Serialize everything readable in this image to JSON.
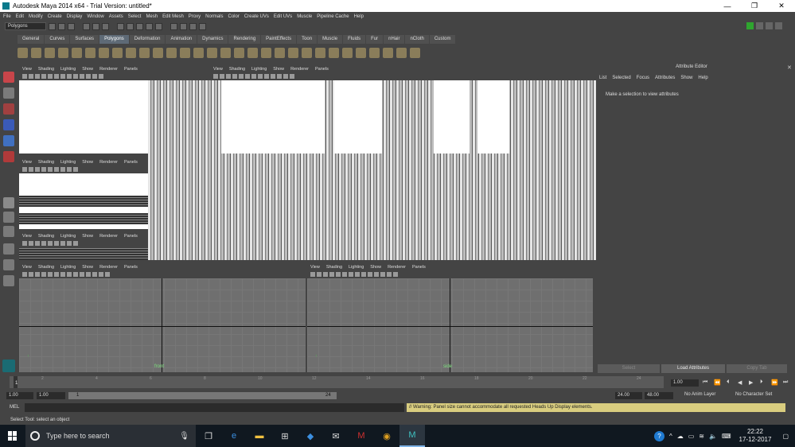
{
  "window": {
    "title": "Autodesk Maya 2014 x64 - Trial Version: untitled*",
    "minimize": "—",
    "maximize": "❐",
    "close": "✕"
  },
  "menu": [
    "File",
    "Edit",
    "Modify",
    "Create",
    "Display",
    "Window",
    "Assets",
    "Select",
    "Mesh",
    "Edit Mesh",
    "Proxy",
    "Normals",
    "Color",
    "Create UVs",
    "Edit UVs",
    "Muscle",
    "Pipeline Cache",
    "Help"
  ],
  "status_line": {
    "mode": "Polygons"
  },
  "shelf": {
    "tabs": [
      "General",
      "Curves",
      "Surfaces",
      "Polygons",
      "Deformation",
      "Animation",
      "Dynamics",
      "Rendering",
      "PaintEffects",
      "Toon",
      "Muscle",
      "Fluids",
      "Fur",
      "nHair",
      "nCloth",
      "Custom"
    ],
    "active_tab": "Polygons"
  },
  "panel_menu": [
    "View",
    "Shading",
    "Lighting",
    "Show",
    "Renderer",
    "Panels"
  ],
  "viewports": {
    "front_label": "front",
    "side_label": "side"
  },
  "attribute_editor": {
    "title": "Attribute Editor",
    "menu": [
      "List",
      "Selected",
      "Focus",
      "Attributes",
      "Show",
      "Help"
    ],
    "hint": "Make a selection to view attributes",
    "buttons": {
      "select": "Select",
      "load": "Load Attributes",
      "copy_tab": "Copy Tab"
    }
  },
  "time_slider": {
    "ticks": [
      "1",
      "2",
      "4",
      "6",
      "8",
      "10",
      "12",
      "14",
      "16",
      "18",
      "20",
      "22",
      "24"
    ],
    "current": "1",
    "current_time_field": "1.00"
  },
  "range_slider": {
    "start": "1.00",
    "playback_start": "1.00",
    "bar_start": "1",
    "bar_end": "24",
    "playback_end": "24.00",
    "end": "48.00",
    "anim_layer": "No Anim Layer",
    "character_set": "No Character Set"
  },
  "command_line": {
    "label": "MEL",
    "warning": "// Warning: Panel size cannot accommodate all requested Heads Up Display elements."
  },
  "help_line": "Select Tool: select an object",
  "taskbar": {
    "search_placeholder": "Type here to search",
    "time": "22:22",
    "date": "17-12-2017"
  }
}
